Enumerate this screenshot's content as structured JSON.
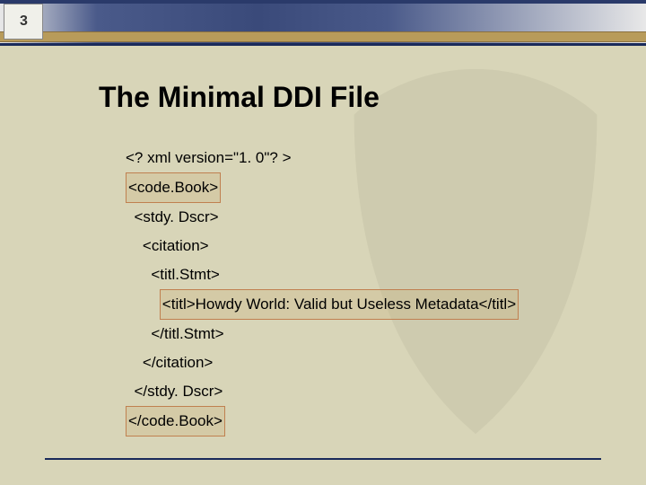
{
  "logo_text": "3",
  "title": "The Minimal DDI File",
  "lines": [
    {
      "indent": 0,
      "text": "<? xml version=\"1. 0\"? >",
      "highlight": false
    },
    {
      "indent": 0,
      "text": "<code.Book>",
      "highlight": true
    },
    {
      "indent": 1,
      "text": "<stdy. Dscr>",
      "highlight": false
    },
    {
      "indent": 2,
      "text": "<citation>",
      "highlight": false
    },
    {
      "indent": 3,
      "text": "<titl.Stmt>",
      "highlight": false
    },
    {
      "indent": 4,
      "text": "<titl>Howdy World: Valid but Useless Metadata</titl>",
      "highlight": true
    },
    {
      "indent": 3,
      "text": "</titl.Stmt>",
      "highlight": false
    },
    {
      "indent": 2,
      "text": "</citation>",
      "highlight": false
    },
    {
      "indent": 1,
      "text": "</stdy. Dscr>",
      "highlight": false
    },
    {
      "indent": 0,
      "text": "</code.Book>",
      "highlight": true
    }
  ]
}
